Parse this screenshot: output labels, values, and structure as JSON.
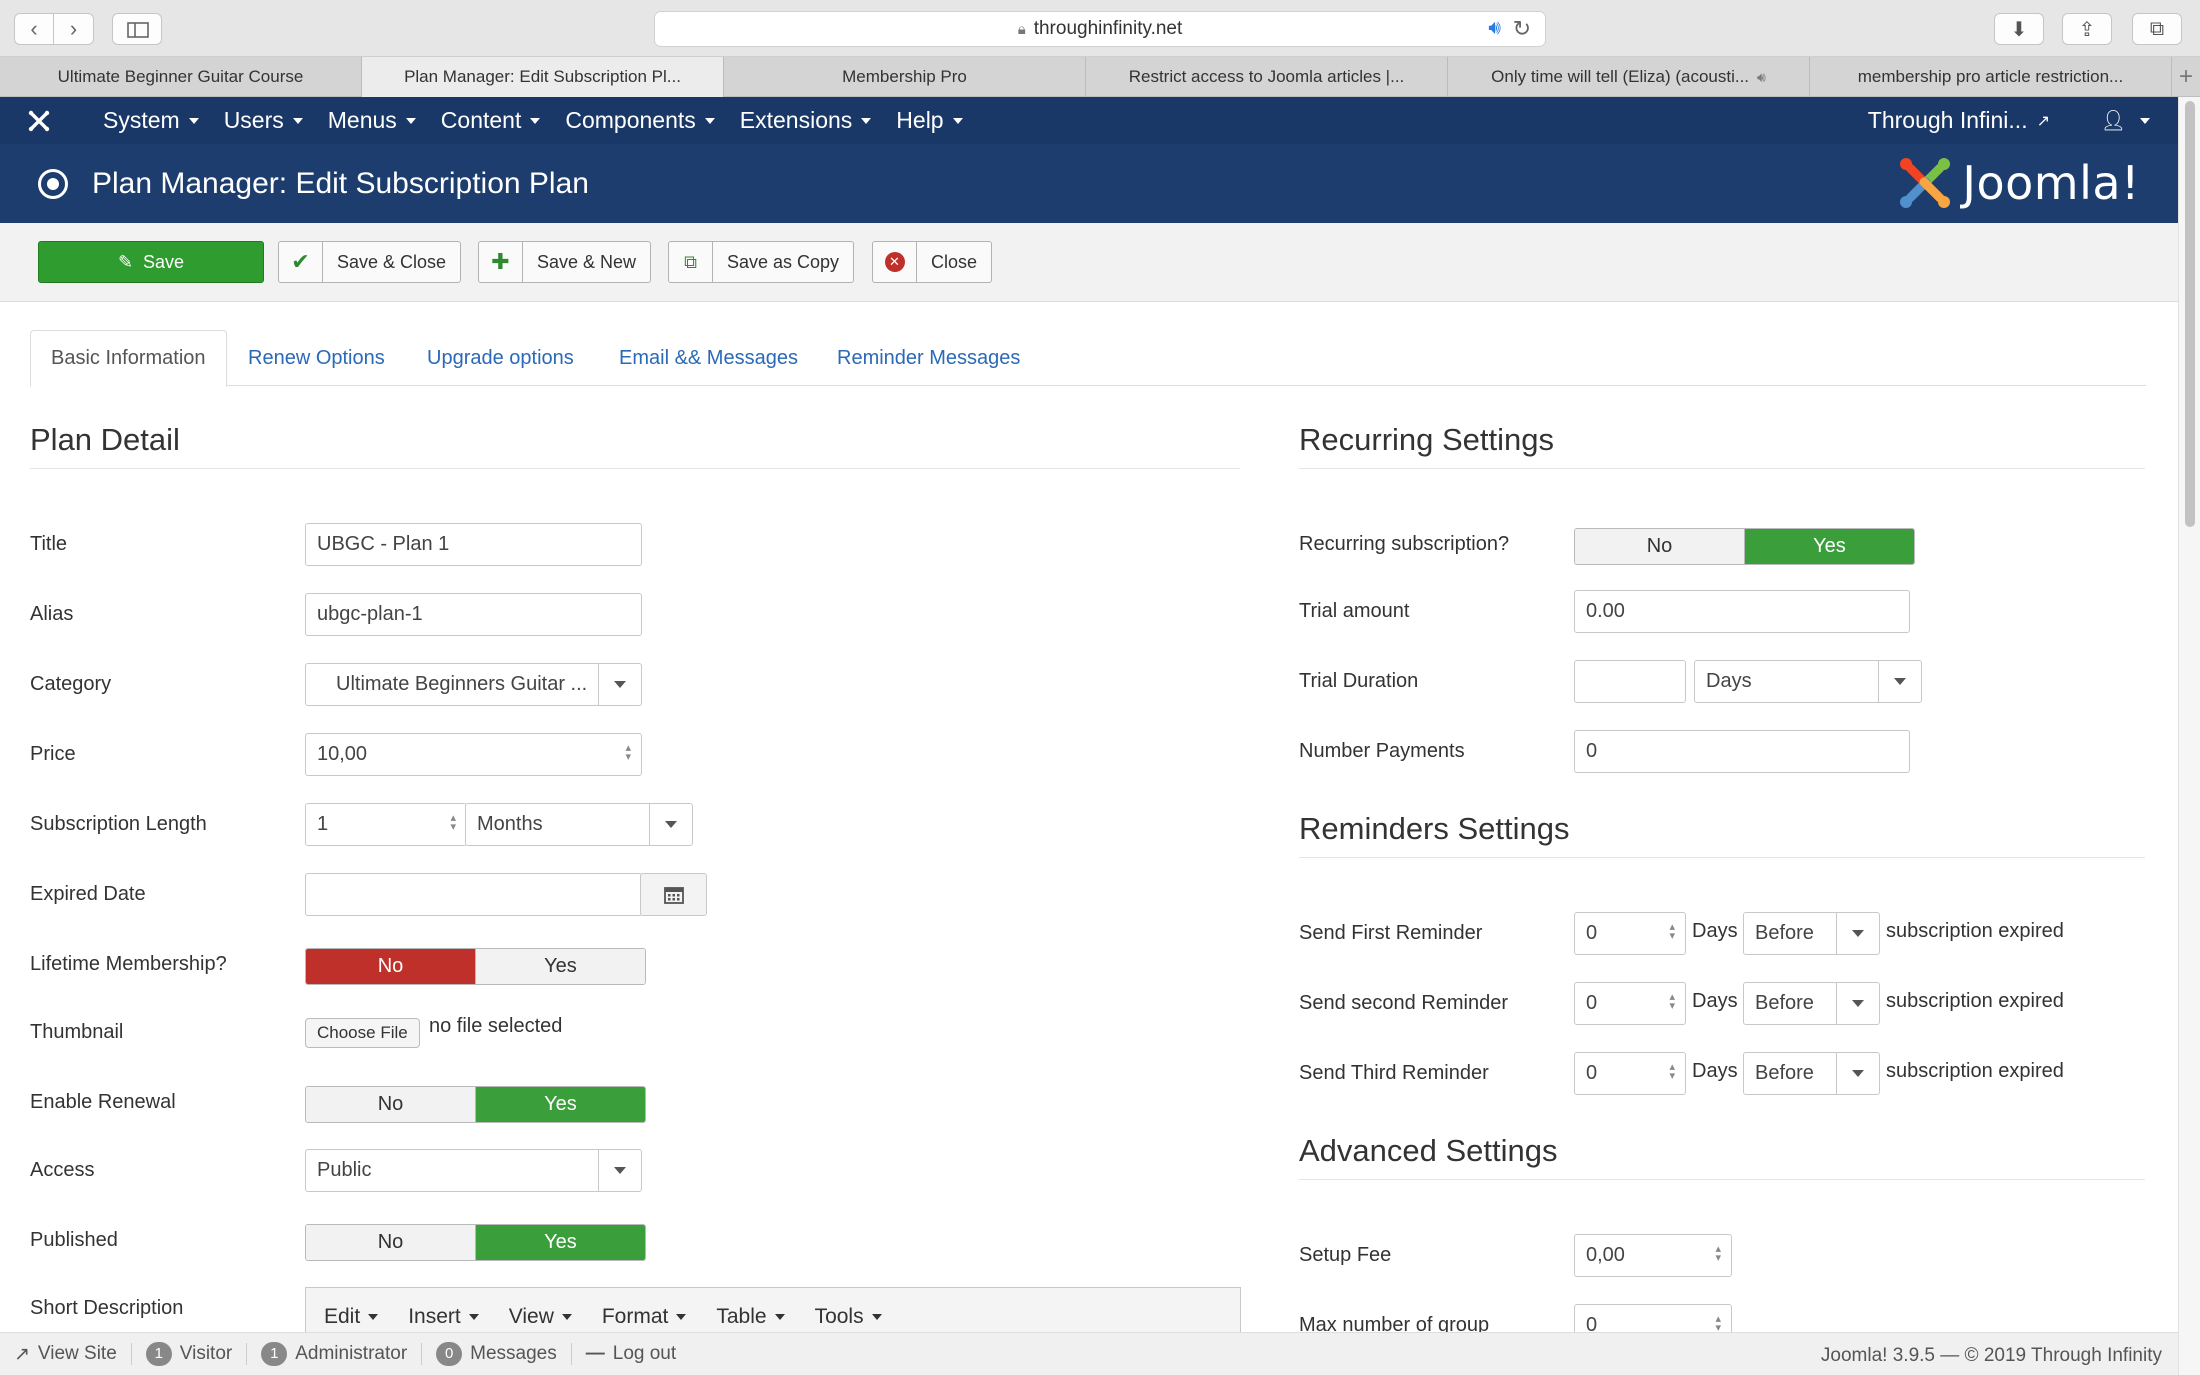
{
  "browser": {
    "url": "throughinfinity.net",
    "tabs": [
      {
        "label": "Ultimate Beginner Guitar Course"
      },
      {
        "label": "Plan Manager: Edit Subscription Pl..."
      },
      {
        "label": "Membership Pro"
      },
      {
        "label": "Restrict access to Joomla articles |..."
      },
      {
        "label": "Only time will tell (Eliza) (acousti..."
      },
      {
        "label": "membership pro article restriction..."
      }
    ]
  },
  "topnav": {
    "menus": [
      "System",
      "Users",
      "Menus",
      "Content",
      "Components",
      "Extensions",
      "Help"
    ],
    "site_name": "Through Infini..."
  },
  "header": {
    "title": "Plan Manager: Edit Subscription Plan",
    "brand": "Joomla!"
  },
  "toolbar": {
    "save": "Save",
    "save_close": "Save & Close",
    "save_new": "Save & New",
    "save_copy": "Save as Copy",
    "close": "Close"
  },
  "page_tabs": [
    "Basic Information",
    "Renew Options",
    "Upgrade options",
    "Email && Messages",
    "Reminder Messages"
  ],
  "plan_detail": {
    "heading": "Plan Detail",
    "title_label": "Title",
    "title_value": "UBGC - Plan 1",
    "alias_label": "Alias",
    "alias_value": "ubgc-plan-1",
    "category_label": "Category",
    "category_value": "Ultimate Beginners Guitar ...",
    "price_label": "Price",
    "price_value": "10,00",
    "length_label": "Subscription Length",
    "length_value": "1",
    "length_unit": "Months",
    "expired_label": "Expired Date",
    "expired_value": "",
    "lifetime_label": "Lifetime Membership?",
    "thumbnail_label": "Thumbnail",
    "choose_file": "Choose File",
    "no_file": "no file selected",
    "renewal_label": "Enable Renewal",
    "access_label": "Access",
    "access_value": "Public",
    "published_label": "Published",
    "short_desc_label": "Short Description",
    "no": "No",
    "yes": "Yes"
  },
  "editor_menus": [
    "Edit",
    "Insert",
    "View",
    "Format",
    "Table",
    "Tools"
  ],
  "recurring": {
    "heading": "Recurring Settings",
    "recurring_label": "Recurring subscription?",
    "trial_amount_label": "Trial amount",
    "trial_amount_value": "0.00",
    "trial_duration_label": "Trial Duration",
    "trial_duration_value": "",
    "trial_duration_unit": "Days",
    "num_payments_label": "Number Payments",
    "num_payments_value": "0"
  },
  "reminders": {
    "heading": "Reminders Settings",
    "days": "Days",
    "before": "Before",
    "suffix": "subscription expired",
    "first_label": "Send First Reminder",
    "first_value": "0",
    "second_label": "Send second Reminder",
    "second_value": "0",
    "third_label": "Send Third Reminder",
    "third_value": "0"
  },
  "advanced": {
    "heading": "Advanced Settings",
    "setup_fee_label": "Setup Fee",
    "setup_fee_value": "0,00",
    "max_group_label": "Max number of group",
    "max_group_value": "0"
  },
  "statusbar": {
    "view_site": "View Site",
    "visitor_count": "1",
    "visitor": "Visitor",
    "admin_count": "1",
    "admin": "Administrator",
    "messages_count": "0",
    "messages": "Messages",
    "logout": "Log out",
    "version": "Joomla! 3.9.5  —  © 2019 Through Infinity"
  },
  "colors": {
    "nav_bg": "#1a3867",
    "title_bg": "#1c3d6e",
    "green": "#2f9c2f",
    "red": "#c0302a",
    "link": "#2a69b8"
  }
}
